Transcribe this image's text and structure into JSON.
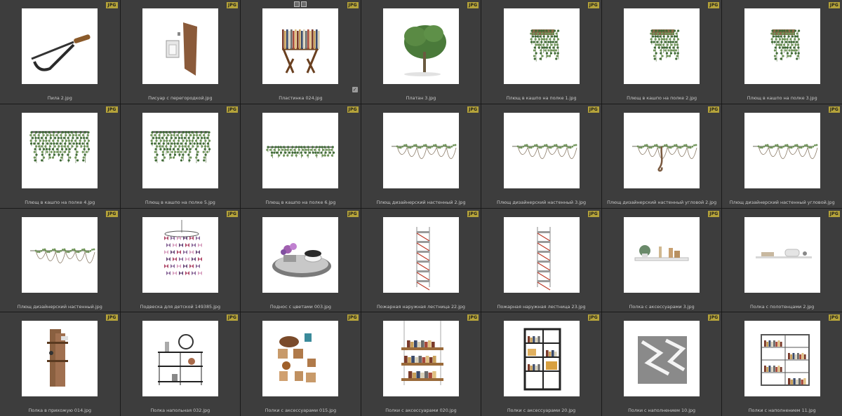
{
  "badge_text": "JPG",
  "items": [
    {
      "label": "Пила 2.jpg",
      "icon": "hacksaw"
    },
    {
      "label": "Писуар с перегородкой.jpg",
      "icon": "urinal-partition"
    },
    {
      "label": "Пластинка 024.jpg",
      "icon": "record-rack",
      "selected": true
    },
    {
      "label": "Платан 3.jpg",
      "icon": "plane-tree"
    },
    {
      "label": "Плющ в кашпо на полке 1.jpg",
      "icon": "ivy-pot"
    },
    {
      "label": "Плющ в кашпо на полке 2.jpg",
      "icon": "ivy-pot"
    },
    {
      "label": "Плющ в кашпо на полке 3.jpg",
      "icon": "ivy-pot"
    },
    {
      "label": "Плющ в кашпо на полке 4.jpg",
      "icon": "ivy-shelf"
    },
    {
      "label": "Плющ в кашпо на полке 5.jpg",
      "icon": "ivy-shelf"
    },
    {
      "label": "Плющ в кашпо на полке 6.jpg",
      "icon": "ivy-shelf-low"
    },
    {
      "label": "Плющ дизайнерский настенный 2.jpg",
      "icon": "ivy-vine"
    },
    {
      "label": "Плющ дизайнерский настенный 3.jpg",
      "icon": "ivy-vine"
    },
    {
      "label": "Плющ дизайнерский настенный угловой 2.jpg",
      "icon": "ivy-vine-trunk"
    },
    {
      "label": "Плющ дизайнерский настенный угловой.jpg",
      "icon": "ivy-vine"
    },
    {
      "label": "Плющ дизайнерский настенный.jpg",
      "icon": "ivy-vine"
    },
    {
      "label": "Подвеска для детской 149385.jpg",
      "icon": "butterfly-mobile"
    },
    {
      "label": "Поднос с цветами 003.jpg",
      "icon": "tray-flowers"
    },
    {
      "label": "Пожарная наружная лестница 22.jpg",
      "icon": "fire-escape"
    },
    {
      "label": "Пожарная наружная лестница 23.jpg",
      "icon": "fire-escape"
    },
    {
      "label": "Полка с аксессуарами 3.jpg",
      "icon": "wall-shelf"
    },
    {
      "label": "Полка с полотенцами 2.jpg",
      "icon": "towel-shelf"
    },
    {
      "label": "Полка в прихожую 014.jpg",
      "icon": "wood-planks"
    },
    {
      "label": "Полка напольная 032.jpg",
      "icon": "floor-shelf"
    },
    {
      "label": "Полки с аксессуарами 015.jpg",
      "icon": "wood-blocks"
    },
    {
      "label": "Полки с аксессуарами 020.jpg",
      "icon": "hanging-shelves"
    },
    {
      "label": "Полки с аксессуарами 20.jpg",
      "icon": "bookcase"
    },
    {
      "label": "Полки с наполнением 10.jpg",
      "icon": "zigzag-shelf"
    },
    {
      "label": "Полки с наполнением 11.jpg",
      "icon": "bookcase-wide"
    }
  ]
}
